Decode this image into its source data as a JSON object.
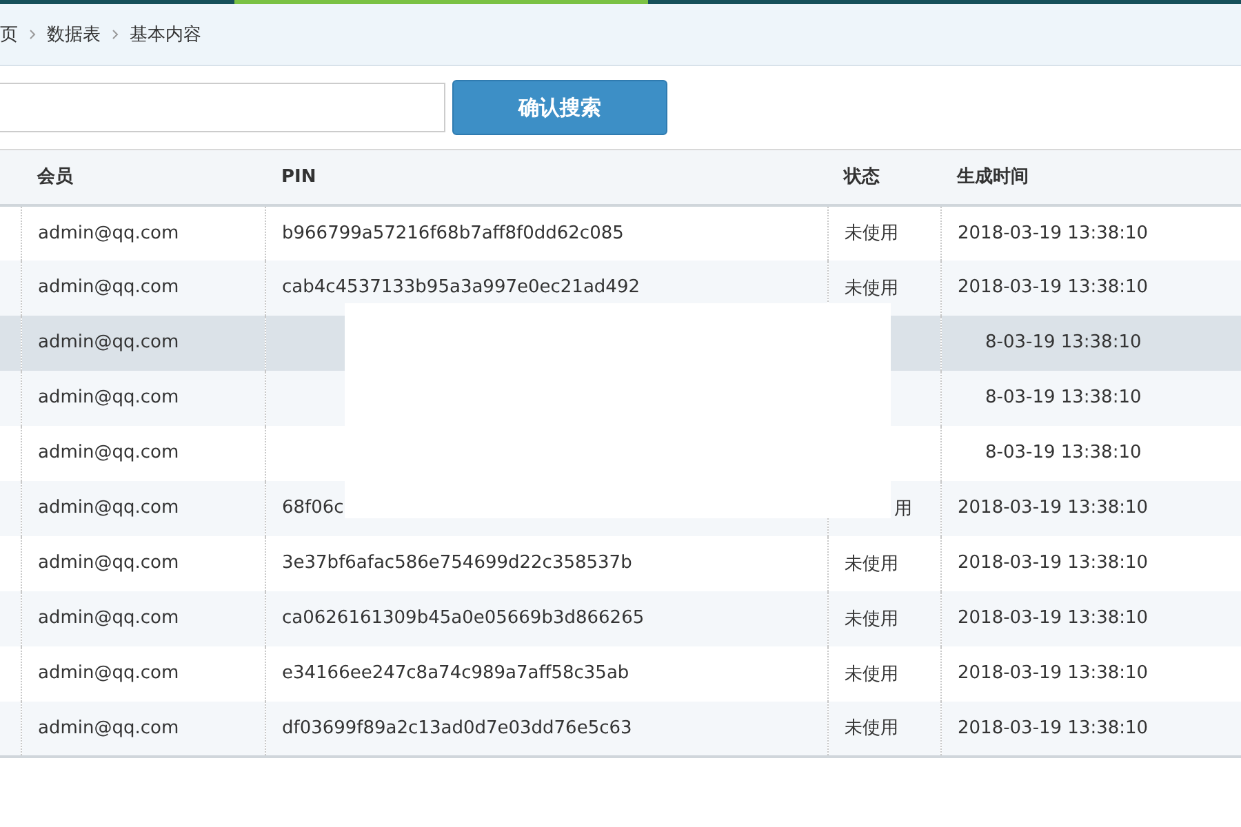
{
  "breadcrumb": [
    {
      "label": "页"
    },
    {
      "label": "数据表"
    },
    {
      "label": "基本内容"
    }
  ],
  "search": {
    "button": "确认搜索"
  },
  "table": {
    "columns": [
      "会员",
      "PIN",
      "状态",
      "生成时间"
    ],
    "rows": [
      {
        "member": "admin@qq.com",
        "pin": "b966799a57216f68b7aff8f0dd62c085",
        "status": "未使用",
        "time": "2018-03-19 13:38:10",
        "selected": false
      },
      {
        "member": "admin@qq.com",
        "pin": "cab4c4537133b95a3a997e0ec21ad492",
        "status": "未使用",
        "time": "2018-03-19 13:38:10",
        "selected": false
      },
      {
        "member": "admin@qq.com",
        "time": "8-03-19 13:38:10",
        "selected": true,
        "partial": true
      },
      {
        "member": "admin@qq.com",
        "time": "8-03-19 13:38:10",
        "selected": false,
        "partial": true
      },
      {
        "member": "admin@qq.com",
        "time": "8-03-19 13:38:10",
        "selected": false,
        "partial": true
      },
      {
        "member": "admin@qq.com",
        "pin": "68f06c",
        "status": "用",
        "time": "2018-03-19 13:38:10",
        "selected": false,
        "partial": true
      },
      {
        "member": "admin@qq.com",
        "pin": "3e37bf6afac586e754699d22c358537b",
        "status": "未使用",
        "time": "2018-03-19 13:38:10",
        "selected": false
      },
      {
        "member": "admin@qq.com",
        "pin": "ca0626161309b45a0e05669b3d866265",
        "status": "未使用",
        "time": "2018-03-19 13:38:10",
        "selected": false
      },
      {
        "member": "admin@qq.com",
        "pin": "e34166ee247c8a74c989a7aff58c35ab",
        "status": "未使用",
        "time": "2018-03-19 13:38:10",
        "selected": false
      },
      {
        "member": "admin@qq.com",
        "pin": "df03699f89a2c13ad0d7e03dd76e5c63",
        "status": "未使用",
        "time": "2018-03-19 13:38:10",
        "selected": false
      }
    ]
  }
}
